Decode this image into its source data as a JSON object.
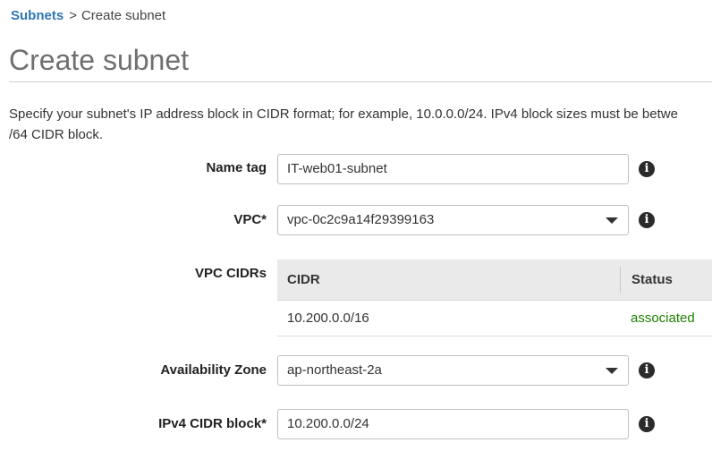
{
  "breadcrumb": {
    "parent": "Subnets",
    "separator": ">",
    "current": "Create subnet"
  },
  "page": {
    "title": "Create subnet",
    "description_line1": "Specify your subnet's IP address block in CIDR format; for example, 10.0.0.0/24. IPv4 block sizes must be betwe",
    "description_line2": "/64 CIDR block."
  },
  "form": {
    "name_tag": {
      "label": "Name tag",
      "value": "IT-web01-subnet"
    },
    "vpc": {
      "label": "VPC*",
      "value": "vpc-0c2c9a14f29399163"
    },
    "vpc_cidrs": {
      "label": "VPC CIDRs",
      "columns": [
        "CIDR",
        "Status"
      ],
      "rows": [
        {
          "cidr": "10.200.0.0/16",
          "status": "associated"
        }
      ]
    },
    "availability_zone": {
      "label": "Availability Zone",
      "value": "ap-northeast-2a"
    },
    "ipv4_cidr_block": {
      "label": "IPv4 CIDR block*",
      "value": "10.200.0.0/24"
    }
  },
  "icons": {
    "info": "info-icon",
    "dropdown": "chevron-down-icon"
  },
  "colors": {
    "link": "#2f76b5",
    "status_ok": "#1d8102",
    "table_header_bg": "#eaeaea"
  }
}
